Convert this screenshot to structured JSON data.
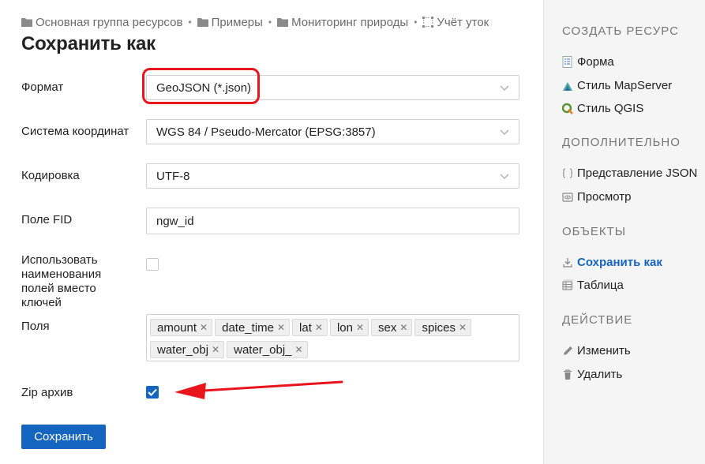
{
  "breadcrumb": [
    {
      "label": "Основная группа ресурсов",
      "icon": "folder-icon"
    },
    {
      "label": "Примеры",
      "icon": "folder-icon"
    },
    {
      "label": "Мониторинг природы",
      "icon": "folder-icon"
    },
    {
      "label": "Учёт уток",
      "icon": "vector-layer-icon"
    }
  ],
  "breadcrumb_separator": "•",
  "page": {
    "title": "Сохранить как"
  },
  "form": {
    "format": {
      "label": "Формат",
      "value": "GeoJSON (*.json)"
    },
    "crs": {
      "label": "Система координат",
      "value": "WGS 84 / Pseudo-Mercator (EPSG:3857)"
    },
    "encoding": {
      "label": "Кодировка",
      "value": "UTF-8"
    },
    "fid": {
      "label": "Поле FID",
      "value": "ngw_id"
    },
    "use_display_names": {
      "label": "Использовать наименования полей вместо ключей",
      "checked": false
    },
    "fields": {
      "label": "Поля",
      "tags": [
        "amount",
        "date_time",
        "lat",
        "lon",
        "sex",
        "spices",
        "water_obj",
        "water_obj_"
      ]
    },
    "zip": {
      "label": "Zip архив",
      "checked": true
    },
    "submit_label": "Сохранить"
  },
  "sidebar": {
    "create": {
      "title": "СОЗДАТЬ РЕСУРС",
      "items": [
        {
          "label": "Форма",
          "icon": "form-icon"
        },
        {
          "label": "Стиль MapServer",
          "icon": "mapserver-icon"
        },
        {
          "label": "Стиль QGIS",
          "icon": "qgis-icon"
        }
      ]
    },
    "extra": {
      "title": "ДОПОЛНИТЕЛЬНО",
      "items": [
        {
          "label": "Представление JSON",
          "icon": "json-braces-icon"
        },
        {
          "label": "Просмотр",
          "icon": "preview-icon"
        }
      ]
    },
    "objects": {
      "title": "ОБЪЕКТЫ",
      "items": [
        {
          "label": "Сохранить как",
          "icon": "download-icon",
          "active": true
        },
        {
          "label": "Таблица",
          "icon": "table-icon"
        }
      ]
    },
    "action": {
      "title": "ДЕЙСТВИЕ",
      "items": [
        {
          "label": "Изменить",
          "icon": "pencil-icon"
        },
        {
          "label": "Удалить",
          "icon": "trash-icon"
        }
      ]
    }
  },
  "colors": {
    "accent": "#1565c0",
    "annotation_red": "#e8151c",
    "sidebar_bg": "#f5f5f5"
  }
}
